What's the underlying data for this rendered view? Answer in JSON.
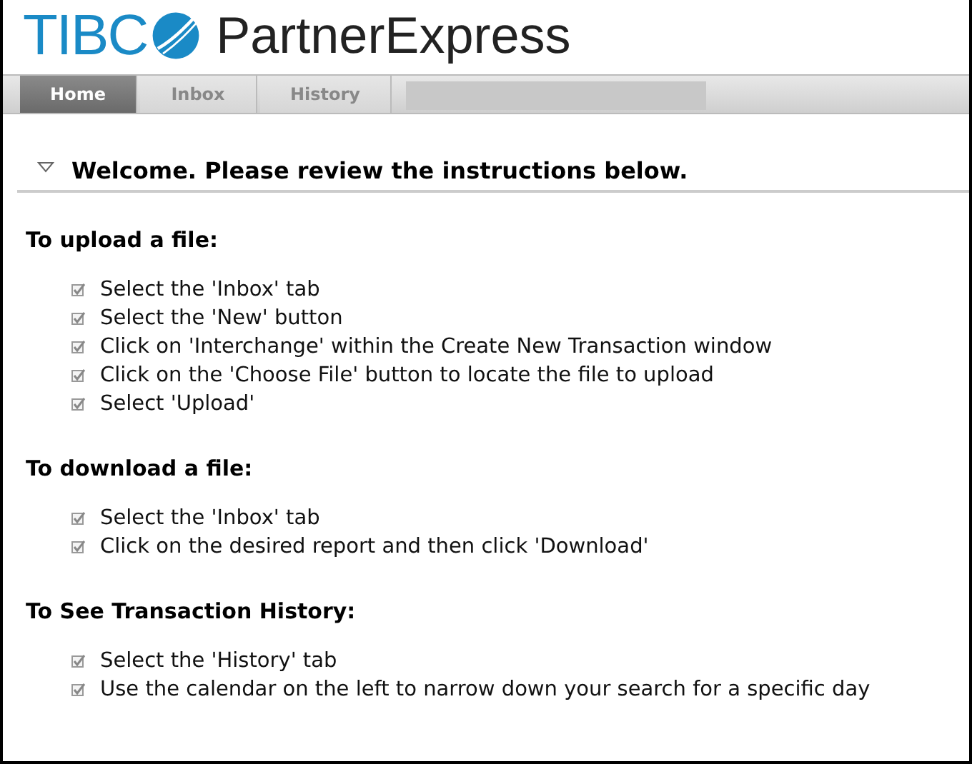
{
  "logo": {
    "text": "TIBC",
    "product": "PartnerExpress"
  },
  "tabs": [
    {
      "label": "Home",
      "selected": true
    },
    {
      "label": "Inbox",
      "selected": false
    },
    {
      "label": "History",
      "selected": false
    }
  ],
  "panel": {
    "title": "Welcome. Please review the instructions below.",
    "expanded": true
  },
  "sections": [
    {
      "heading": "To upload a file:",
      "steps": [
        {
          "text": "Select the 'Inbox' tab",
          "checked": true
        },
        {
          "text": "Select the 'New' button",
          "checked": true
        },
        {
          "text": "Click on 'Interchange' within the Create New Transaction window",
          "checked": true
        },
        {
          "text": "Click on the 'Choose File' button to locate the file to upload",
          "checked": true
        },
        {
          "text": "Select 'Upload'",
          "checked": true
        }
      ]
    },
    {
      "heading": "To download a file:",
      "steps": [
        {
          "text": "Select the 'Inbox' tab",
          "checked": true
        },
        {
          "text": "Click on the desired report and then click 'Download'",
          "checked": true
        }
      ]
    },
    {
      "heading": "To See Transaction History:",
      "steps": [
        {
          "text": "Select the 'History' tab",
          "checked": true
        },
        {
          "text": "Use the calendar on the left to narrow down your search for a specific day",
          "checked": true
        }
      ]
    }
  ]
}
